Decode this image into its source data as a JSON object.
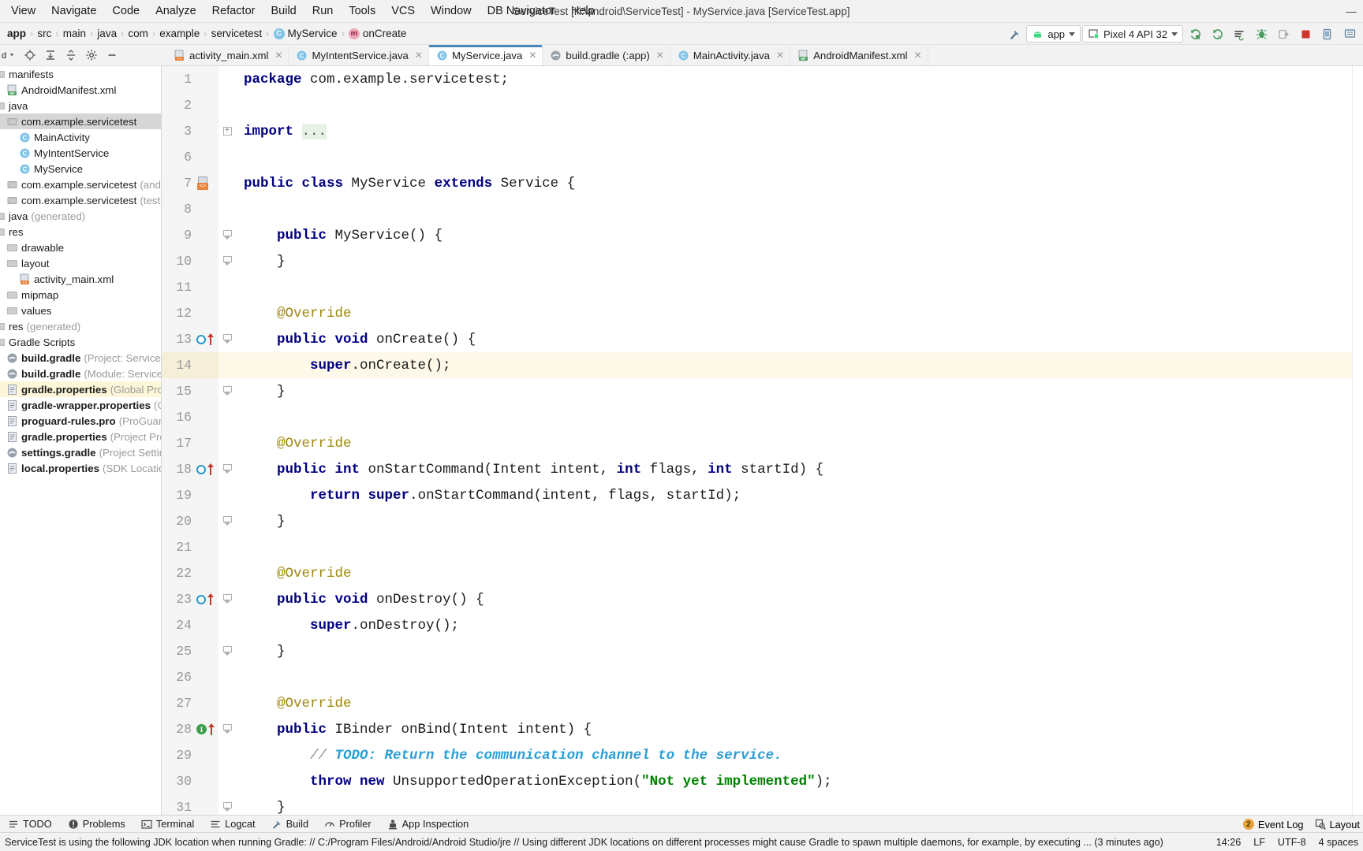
{
  "window": {
    "title": "ServiceTest [K:\\android\\ServiceTest] - MyService.java [ServiceTest.app]",
    "minimize": "—",
    "maximize": "□",
    "close": "✕"
  },
  "menubar": {
    "items": [
      {
        "label": "View"
      },
      {
        "label": "Navigate"
      },
      {
        "label": "Code"
      },
      {
        "label": "Analyze"
      },
      {
        "label": "Refactor"
      },
      {
        "label": "Build"
      },
      {
        "label": "Run"
      },
      {
        "label": "Tools"
      },
      {
        "label": "VCS"
      },
      {
        "label": "Window"
      },
      {
        "label": "DB Navigator"
      },
      {
        "label": "Help"
      }
    ]
  },
  "breadcrumb": {
    "separator": "›",
    "items": [
      {
        "label": "app",
        "kind": "module"
      },
      {
        "label": "src",
        "kind": "dir"
      },
      {
        "label": "main",
        "kind": "dir"
      },
      {
        "label": "java",
        "kind": "dir"
      },
      {
        "label": "com",
        "kind": "dir"
      },
      {
        "label": "example",
        "kind": "dir"
      },
      {
        "label": "servicetest",
        "kind": "dir"
      },
      {
        "label": "MyService",
        "kind": "class",
        "badge": "C"
      },
      {
        "label": "onCreate",
        "kind": "method",
        "badge": "m"
      }
    ]
  },
  "toolbar": {
    "build_label": "build-hammer-icon",
    "run_config": "app",
    "device": "Pixel 4 API 32",
    "icons": [
      "run-icon",
      "run-coverage-icon",
      "run-with-profiler-icon",
      "debug-icon",
      "attach-debugger-icon",
      "stop-icon",
      "avd-manager-icon",
      "sdk-manager-icon"
    ]
  },
  "project_panel": {
    "toolbar_icons": [
      "select-opened-file-icon",
      "expand-all-icon",
      "collapse-all-icon",
      "settings-gear-icon",
      "hide-icon"
    ],
    "tree": [
      {
        "label": "manifests",
        "indent": 0,
        "type": "folder",
        "state": "plain"
      },
      {
        "label": "AndroidManifest.xml",
        "indent": 1,
        "type": "manifest-file",
        "state": "plain"
      },
      {
        "label": "java",
        "indent": 0,
        "type": "folder",
        "state": "plain"
      },
      {
        "label": "com.example.servicetest",
        "indent": 1,
        "type": "package",
        "state": "selected"
      },
      {
        "label": "MainActivity",
        "indent": 2,
        "type": "class",
        "state": "plain"
      },
      {
        "label": "MyIntentService",
        "indent": 2,
        "type": "class",
        "state": "plain"
      },
      {
        "label": "MyService",
        "indent": 2,
        "type": "class",
        "state": "plain"
      },
      {
        "label": "com.example.servicetest",
        "suffix": "(androidTest)",
        "indent": 1,
        "type": "package",
        "state": "plain"
      },
      {
        "label": "com.example.servicetest",
        "suffix": "(test)",
        "indent": 1,
        "type": "package",
        "state": "plain"
      },
      {
        "label": "java",
        "suffix": "(generated)",
        "indent": 0,
        "type": "folder",
        "state": "plain"
      },
      {
        "label": "res",
        "indent": 0,
        "type": "folder",
        "state": "plain"
      },
      {
        "label": "drawable",
        "indent": 1,
        "type": "folder",
        "state": "plain"
      },
      {
        "label": "layout",
        "indent": 1,
        "type": "folder",
        "state": "plain"
      },
      {
        "label": "activity_main.xml",
        "indent": 2,
        "type": "layout-file",
        "state": "plain"
      },
      {
        "label": "mipmap",
        "indent": 1,
        "type": "folder",
        "state": "plain"
      },
      {
        "label": "values",
        "indent": 1,
        "type": "folder",
        "state": "plain"
      },
      {
        "label": "res",
        "suffix": "(generated)",
        "indent": 0,
        "type": "folder",
        "state": "plain"
      },
      {
        "label": "Gradle Scripts",
        "indent": 0,
        "type": "gradle-root",
        "state": "plain"
      },
      {
        "label": "build.gradle",
        "suffix": "(Project: ServiceTest)",
        "indent": 1,
        "type": "gradle-file",
        "state": "plain",
        "bold": true
      },
      {
        "label": "build.gradle",
        "suffix": "(Module: ServiceTest.a",
        "indent": 1,
        "type": "gradle-file",
        "state": "plain",
        "bold": true
      },
      {
        "label": "gradle.properties",
        "suffix": "(Global Propertie",
        "indent": 1,
        "type": "props-file",
        "state": "highlight",
        "bold": true
      },
      {
        "label": "gradle-wrapper.properties",
        "suffix": "(Gradle",
        "indent": 1,
        "type": "props-file",
        "state": "plain",
        "bold": true
      },
      {
        "label": "proguard-rules.pro",
        "suffix": "(ProGuard Rule",
        "indent": 1,
        "type": "props-file",
        "state": "plain",
        "bold": true
      },
      {
        "label": "gradle.properties",
        "suffix": "(Project Propertie",
        "indent": 1,
        "type": "props-file",
        "state": "plain",
        "bold": true
      },
      {
        "label": "settings.gradle",
        "suffix": "(Project Settings)",
        "indent": 1,
        "type": "gradle-file",
        "state": "plain",
        "bold": true
      },
      {
        "label": "local.properties",
        "suffix": "(SDK Location)",
        "indent": 1,
        "type": "props-file",
        "state": "plain",
        "bold": true
      }
    ]
  },
  "editor_tabs": [
    {
      "label": "activity_main.xml",
      "icon": "layout-xml-icon",
      "active": false
    },
    {
      "label": "MyIntentService.java",
      "icon": "java-class-icon",
      "active": false
    },
    {
      "label": "MyService.java",
      "icon": "java-class-icon",
      "active": true
    },
    {
      "label": "build.gradle (:app)",
      "icon": "gradle-icon",
      "active": false
    },
    {
      "label": "MainActivity.java",
      "icon": "java-class-icon",
      "active": false
    },
    {
      "label": "AndroidManifest.xml",
      "icon": "manifest-icon",
      "active": false
    }
  ],
  "editor": {
    "active_file": "MyService.java",
    "caret_line": 14,
    "lines": [
      {
        "n": 1,
        "indent": 0,
        "fold": "",
        "gutter": "",
        "tokens": [
          [
            "kw",
            "package"
          ],
          [
            "plain",
            " com.example.servicetest;"
          ]
        ]
      },
      {
        "n": 2,
        "indent": 0,
        "fold": "",
        "gutter": "",
        "tokens": [
          [
            "plain",
            ""
          ]
        ]
      },
      {
        "n": 3,
        "indent": 0,
        "fold": "plus",
        "gutter": "",
        "tokens": [
          [
            "kw",
            "import"
          ],
          [
            "plain",
            " "
          ],
          [
            "fold",
            "..."
          ]
        ]
      },
      {
        "n": 6,
        "indent": 0,
        "fold": "",
        "gutter": "",
        "tokens": [
          [
            "plain",
            ""
          ]
        ]
      },
      {
        "n": 7,
        "indent": 0,
        "fold": "",
        "gutter": "class-file",
        "tokens": [
          [
            "kw",
            "public class"
          ],
          [
            "plain",
            " MyService "
          ],
          [
            "kw",
            "extends"
          ],
          [
            "plain",
            " Service {"
          ]
        ]
      },
      {
        "n": 8,
        "indent": 0,
        "fold": "",
        "gutter": "",
        "tokens": [
          [
            "plain",
            ""
          ]
        ]
      },
      {
        "n": 9,
        "indent": 1,
        "fold": "end",
        "gutter": "",
        "tokens": [
          [
            "kw",
            "public"
          ],
          [
            "plain",
            " MyService() {"
          ]
        ]
      },
      {
        "n": 10,
        "indent": 1,
        "fold": "end",
        "gutter": "",
        "tokens": [
          [
            "plain",
            "}"
          ]
        ]
      },
      {
        "n": 11,
        "indent": 0,
        "fold": "",
        "gutter": "",
        "tokens": [
          [
            "plain",
            ""
          ]
        ]
      },
      {
        "n": 12,
        "indent": 1,
        "fold": "",
        "gutter": "",
        "tokens": [
          [
            "ann",
            "@Override"
          ]
        ]
      },
      {
        "n": 13,
        "indent": 1,
        "fold": "end",
        "gutter": "override",
        "tokens": [
          [
            "kw",
            "public void"
          ],
          [
            "plain",
            " onCreate() {"
          ]
        ]
      },
      {
        "n": 14,
        "indent": 2,
        "fold": "",
        "gutter": "",
        "tokens": [
          [
            "kw",
            "super"
          ],
          [
            "plain",
            ".onCreate();"
          ]
        ]
      },
      {
        "n": 15,
        "indent": 1,
        "fold": "end",
        "gutter": "",
        "tokens": [
          [
            "plain",
            "}"
          ]
        ]
      },
      {
        "n": 16,
        "indent": 0,
        "fold": "",
        "gutter": "",
        "tokens": [
          [
            "plain",
            ""
          ]
        ]
      },
      {
        "n": 17,
        "indent": 1,
        "fold": "",
        "gutter": "",
        "tokens": [
          [
            "ann",
            "@Override"
          ]
        ]
      },
      {
        "n": 18,
        "indent": 1,
        "fold": "end",
        "gutter": "override",
        "tokens": [
          [
            "kw",
            "public int"
          ],
          [
            "plain",
            " onStartCommand(Intent intent, "
          ],
          [
            "kw",
            "int"
          ],
          [
            "plain",
            " flags, "
          ],
          [
            "kw",
            "int"
          ],
          [
            "plain",
            " startId) {"
          ]
        ]
      },
      {
        "n": 19,
        "indent": 2,
        "fold": "",
        "gutter": "",
        "tokens": [
          [
            "kw",
            "return"
          ],
          [
            "plain",
            " "
          ],
          [
            "kw",
            "super"
          ],
          [
            "plain",
            ".onStartCommand(intent, flags, startId);"
          ]
        ]
      },
      {
        "n": 20,
        "indent": 1,
        "fold": "end",
        "gutter": "",
        "tokens": [
          [
            "plain",
            "}"
          ]
        ]
      },
      {
        "n": 21,
        "indent": 0,
        "fold": "",
        "gutter": "",
        "tokens": [
          [
            "plain",
            ""
          ]
        ]
      },
      {
        "n": 22,
        "indent": 1,
        "fold": "",
        "gutter": "",
        "tokens": [
          [
            "ann",
            "@Override"
          ]
        ]
      },
      {
        "n": 23,
        "indent": 1,
        "fold": "end",
        "gutter": "override",
        "tokens": [
          [
            "kw",
            "public void"
          ],
          [
            "plain",
            " onDestroy() {"
          ]
        ]
      },
      {
        "n": 24,
        "indent": 2,
        "fold": "",
        "gutter": "",
        "tokens": [
          [
            "kw",
            "super"
          ],
          [
            "plain",
            ".onDestroy();"
          ]
        ]
      },
      {
        "n": 25,
        "indent": 1,
        "fold": "end",
        "gutter": "",
        "tokens": [
          [
            "plain",
            "}"
          ]
        ]
      },
      {
        "n": 26,
        "indent": 0,
        "fold": "",
        "gutter": "",
        "tokens": [
          [
            "plain",
            ""
          ]
        ]
      },
      {
        "n": 27,
        "indent": 1,
        "fold": "",
        "gutter": "",
        "tokens": [
          [
            "ann",
            "@Override"
          ]
        ]
      },
      {
        "n": 28,
        "indent": 1,
        "fold": "end",
        "gutter": "implement",
        "tokens": [
          [
            "kw",
            "public"
          ],
          [
            "plain",
            " IBinder onBind(Intent intent) {"
          ]
        ]
      },
      {
        "n": 29,
        "indent": 2,
        "fold": "",
        "gutter": "",
        "tokens": [
          [
            "cmt",
            "// "
          ],
          [
            "todo",
            "TODO: Return the communication channel to the service."
          ]
        ]
      },
      {
        "n": 30,
        "indent": 2,
        "fold": "",
        "gutter": "",
        "tokens": [
          [
            "kw",
            "throw new"
          ],
          [
            "plain",
            " UnsupportedOperationException("
          ],
          [
            "str",
            "\"Not yet implemented\""
          ],
          [
            "plain",
            ");"
          ]
        ]
      },
      {
        "n": 31,
        "indent": 1,
        "fold": "end",
        "gutter": "",
        "tokens": [
          [
            "plain",
            "}"
          ]
        ]
      }
    ]
  },
  "bottom_toolwindows": [
    {
      "label": "TODO",
      "icon": "todo-icon"
    },
    {
      "label": "Problems",
      "icon": "problems-icon"
    },
    {
      "label": "Terminal",
      "icon": "terminal-icon"
    },
    {
      "label": "Logcat",
      "icon": "logcat-icon"
    },
    {
      "label": "Build",
      "icon": "build-hammer-icon"
    },
    {
      "label": "Profiler",
      "icon": "profiler-icon"
    },
    {
      "label": "App Inspection",
      "icon": "app-inspection-icon"
    }
  ],
  "bottom_right": {
    "event_log": "Event Log",
    "event_count": "2",
    "layout_inspector": "Layout"
  },
  "statusbar": {
    "message": "ServiceTest is using the following JDK location when running Gradle: // C:/Program Files/Android/Android Studio/jre // Using different JDK locations on different processes might cause Gradle to spawn multiple daemons, for example, by executing ... (3 minutes ago)",
    "time": "14:26",
    "line_separator": "LF",
    "encoding": "UTF-8",
    "indent": "4 spaces"
  },
  "colors": {
    "accent_blue": "#4a87bf",
    "keyword": "#000080",
    "string": "#008000",
    "annotation": "#9e880d",
    "todo": "#2a9fd6",
    "selection": "#d6d6d6",
    "caret_line": "#fdf8e8",
    "android_green": "#3ddc84"
  }
}
